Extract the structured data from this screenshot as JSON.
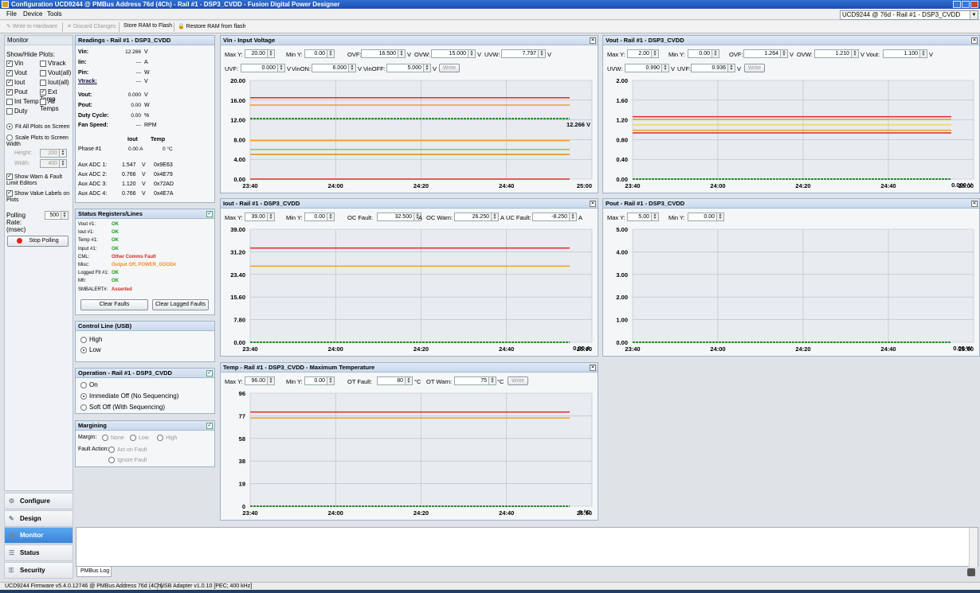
{
  "window": {
    "title": "Configuration UCD9244 @ PMBus Address 76d (4Ch) - Rail #1 - DSP3_CVDD - Fusion Digital Power Designer"
  },
  "menu": [
    "File",
    "Device",
    "Tools"
  ],
  "device_select": "UCD9244 @ 76d - Rail #1 - DSP3_CVDD",
  "toolbar": {
    "write": "Write to Hardware",
    "discard": "Discard Changes",
    "store": "Store RAM to Flash",
    "restore": "Restore RAM from flash"
  },
  "left": {
    "header": "Monitor",
    "show_hide": "Show/Hide Plots:",
    "plots": [
      {
        "a": "Vin",
        "ac": true,
        "b": "Vtrack",
        "bc": false
      },
      {
        "a": "Vout",
        "ac": true,
        "b": "Vout(all)",
        "bc": false
      },
      {
        "a": "Iout",
        "ac": true,
        "b": "Iout(all)",
        "bc": false
      },
      {
        "a": "Pout",
        "ac": true,
        "b": "Ext Temp",
        "bc": true
      },
      {
        "a": "Int Temp",
        "ac": false,
        "b": "All Temps",
        "bc": false
      },
      {
        "a": "Duty",
        "ac": false,
        "b": "",
        "bc": false
      }
    ],
    "fit": "Fit All Plots on Screen",
    "scale": "Scale Plots to Screen Width",
    "height_label": "Height:",
    "height": "200",
    "width_label": "Width:",
    "width": "400",
    "show_warn": "Show Warn & Fault Limit Editors",
    "show_values": "Show Value Labels on Plots",
    "polling_label": "Polling Rate: (msec)",
    "polling": "500",
    "stop": "Stop Polling"
  },
  "nav": [
    "Configure",
    "Design",
    "Monitor",
    "Status",
    "Security"
  ],
  "readings": {
    "title": "Readings - Rail #1 - DSP3_CVDD",
    "rows": [
      {
        "label": "Vin:",
        "value": "12.266",
        "unit": "V"
      },
      {
        "label": "Iin:",
        "value": "---",
        "unit": "A"
      },
      {
        "label": "Pin:",
        "value": "---",
        "unit": "W"
      },
      {
        "label": "Vtrack:",
        "value": "---",
        "unit": "V"
      },
      {
        "label": "Vout:",
        "value": "0.000",
        "unit": "V"
      },
      {
        "label": "Pout:",
        "value": "0.00",
        "unit": "W"
      },
      {
        "label": "Duty Cycle:",
        "value": "0.00",
        "unit": "%"
      },
      {
        "label": "Fan Speed:",
        "value": "---",
        "unit": "RPM"
      }
    ],
    "iout_h": "Iout",
    "temp_h": "Temp",
    "phase": "Phase #1",
    "phase_iout": "0.00 A",
    "phase_temp": "0 °C",
    "aux": [
      {
        "label": "Aux ADC 1:",
        "value": "1.547",
        "unit": "V",
        "hex": "0x9E63"
      },
      {
        "label": "Aux ADC 2:",
        "value": "0.766",
        "unit": "V",
        "hex": "0x4E79"
      },
      {
        "label": "Aux ADC 3:",
        "value": "1.120",
        "unit": "V",
        "hex": "0x72AD"
      },
      {
        "label": "Aux ADC 4:",
        "value": "0.766",
        "unit": "V",
        "hex": "0x4E7A"
      }
    ]
  },
  "status": {
    "title": "Status Registers/Lines",
    "rows": [
      {
        "label": "Vout #1:",
        "value": "OK",
        "kind": "ok"
      },
      {
        "label": "Iout #1:",
        "value": "OK",
        "kind": "ok"
      },
      {
        "label": "Temp #1:",
        "value": "OK",
        "kind": "ok"
      },
      {
        "label": "Input #1:",
        "value": "OK",
        "kind": "ok"
      },
      {
        "label": "CML:",
        "value": "Other Comms Fault",
        "kind": "fault"
      },
      {
        "label": "Misc:",
        "value": "Output Off, POWER_GOOD#",
        "kind": "warn"
      },
      {
        "label": "Logged Flt #1:",
        "value": "OK",
        "kind": "ok"
      },
      {
        "label": "Mfr:",
        "value": "OK",
        "kind": "ok"
      },
      {
        "label": "SMBALERT#:",
        "value": "Asserted",
        "kind": "fault"
      }
    ],
    "clear": "Clear Faults",
    "clear_logged": "Clear Logged Faults"
  },
  "control": {
    "title": "Control Line (USB)",
    "high": "High",
    "low": "Low"
  },
  "operation": {
    "title": "Operation - Rail #1 - DSP3_CVDD",
    "on": "On",
    "imm": "Immediate Off (No Sequencing)",
    "soft": "Soft Off (With Sequencing)"
  },
  "margining": {
    "title": "Margining",
    "margin": "Margin:",
    "none": "None",
    "low": "Low",
    "high": "High",
    "fault": "Fault Action:",
    "act": "Act on Fault",
    "ignore": "Ignore Fault"
  },
  "plots": {
    "vin": {
      "title": "Vin - Input Voltage",
      "maxy": "20.00",
      "miny": "0.00",
      "ovf": "16.500",
      "ovw": "15.000",
      "uvw": "7.797",
      "uvf": "0.000",
      "vinon": "6.000",
      "vinoff": "5.000",
      "readout": "12.266 V"
    },
    "vout": {
      "title": "Vout - Rail #1 - DSP3_CVDD",
      "maxy": "2.00",
      "miny": "0.00",
      "ovf": "1.264",
      "ovw": "1.210",
      "vout": "1.100",
      "uvw": "0.990",
      "uvf": "0.936",
      "readout": "0.000 V"
    },
    "iout": {
      "title": "Iout - Rail #1 - DSP3_CVDD",
      "maxy": "39.00",
      "miny": "0.00",
      "ocf": "32.500",
      "ocw": "26.250",
      "ucf": "-8.250",
      "readout": "0.00 A"
    },
    "pout": {
      "title": "Pout - Rail #1 - DSP3_CVDD",
      "maxy": "5.00",
      "miny": "0.00",
      "readout": "0.00 W"
    },
    "temp": {
      "title": "Temp - Rail #1 - DSP3_CVDD - Maximum Temperature",
      "maxy": "96.00",
      "miny": "0.00",
      "otf": "80",
      "otw": "75",
      "readout": "0 °C"
    },
    "labels": {
      "maxy": "Max Y:",
      "miny": "Min Y:",
      "ovf": "OVF:",
      "ovw": "OVW:",
      "uvw": "UVW:",
      "uvf": "UVF:",
      "vinon": "VinON:",
      "vinoff": "VinOFF:",
      "vout": "Vout:",
      "ocf": "OC Fault:",
      "ocw": "OC Warn:",
      "ucf": "UC Fault:",
      "otf": "OT Fault:",
      "otw": "OT Warn:",
      "write": "Write",
      "v": "V",
      "a": "A",
      "degc": "°C"
    }
  },
  "chart_data": [
    {
      "type": "line",
      "title": "Vin - Input Voltage",
      "x_ticks": [
        "23:40",
        "24:00",
        "24:20",
        "24:40",
        "25:00"
      ],
      "y_ticks": [
        "20.00",
        "16.00",
        "12.00",
        "8.00",
        "4.00",
        "0.00"
      ],
      "ylim": [
        0,
        20
      ],
      "grid": true,
      "limits": [
        {
          "name": "OVF",
          "value": 16.5,
          "color": "#e02a2a"
        },
        {
          "name": "OVW",
          "value": 15.0,
          "color": "#f0a020"
        },
        {
          "name": "UVW",
          "value": 7.797,
          "color": "#f0a020"
        },
        {
          "name": "VinON",
          "value": 6.0,
          "color": "#9acd32"
        },
        {
          "name": "VinOFF",
          "value": 5.0,
          "color": "#e08a20"
        },
        {
          "name": "UVF",
          "value": 0.0,
          "color": "#e02a2a"
        }
      ],
      "series": [
        {
          "values": [
            12.266
          ],
          "color": "#2e8b2e"
        }
      ]
    },
    {
      "type": "line",
      "title": "Vout - Rail #1 - DSP3_CVDD",
      "x_ticks": [
        "23:40",
        "24:00",
        "24:20",
        "24:40",
        "25:00"
      ],
      "y_ticks": [
        "2.00",
        "1.60",
        "1.20",
        "0.80",
        "0.40",
        "0.00"
      ],
      "ylim": [
        0,
        2
      ],
      "grid": true,
      "limits": [
        {
          "name": "OVF",
          "value": 1.264,
          "color": "#e02a2a"
        },
        {
          "name": "OVW",
          "value": 1.21,
          "color": "#f0a020"
        },
        {
          "name": "Vout",
          "value": 1.1,
          "color": "#f3d080"
        },
        {
          "name": "UVW",
          "value": 0.99,
          "color": "#f0a020"
        },
        {
          "name": "UVF",
          "value": 0.936,
          "color": "#e02a2a"
        }
      ],
      "series": [
        {
          "values": [
            0.0
          ],
          "color": "#2e8b2e"
        }
      ]
    },
    {
      "type": "line",
      "title": "Iout - Rail #1 - DSP3_CVDD",
      "x_ticks": [
        "23:40",
        "24:00",
        "24:20",
        "24:40",
        "25:00"
      ],
      "y_ticks": [
        "39.00",
        "31.20",
        "23.40",
        "15.60",
        "7.80",
        "0.00"
      ],
      "ylim": [
        0,
        39
      ],
      "grid": true,
      "limits": [
        {
          "name": "OC Fault",
          "value": 32.5,
          "color": "#e02a2a"
        },
        {
          "name": "OC Warn",
          "value": 26.25,
          "color": "#f0a020"
        }
      ],
      "series": [
        {
          "values": [
            0.0
          ],
          "color": "#2e8b2e"
        }
      ]
    },
    {
      "type": "line",
      "title": "Pout - Rail #1 - DSP3_CVDD",
      "x_ticks": [
        "23:40",
        "24:00",
        "24:20",
        "24:40",
        "25:00"
      ],
      "y_ticks": [
        "5.00",
        "4.00",
        "3.00",
        "2.00",
        "1.00",
        "0.00"
      ],
      "ylim": [
        0,
        5
      ],
      "grid": true,
      "limits": [],
      "series": [
        {
          "values": [
            0.0
          ],
          "color": "#2e8b2e"
        }
      ]
    },
    {
      "type": "line",
      "title": "Temp - Rail #1 - DSP3_CVDD - Maximum Temperature",
      "x_ticks": [
        "23:40",
        "24:00",
        "24:20",
        "24:40",
        "25:00"
      ],
      "y_ticks": [
        "96",
        "77",
        "58",
        "38",
        "19",
        "0"
      ],
      "ylim": [
        0,
        96
      ],
      "grid": true,
      "limits": [
        {
          "name": "OT Fault",
          "value": 80,
          "color": "#e02a2a"
        },
        {
          "name": "OT Warn",
          "value": 75,
          "color": "#f0a020"
        }
      ],
      "series": [
        {
          "values": [
            0.0
          ],
          "color": "#2e8b2e"
        }
      ]
    }
  ],
  "log": {
    "tab": "PMBus Log"
  },
  "statusbar": {
    "fw": "UCD9244 Firmware v5.4.0.12746 @ PMBus Address 76d (4Ch)",
    "adapter": "USB Adapter v1.0.10 [PEC; 400 kHz]"
  }
}
